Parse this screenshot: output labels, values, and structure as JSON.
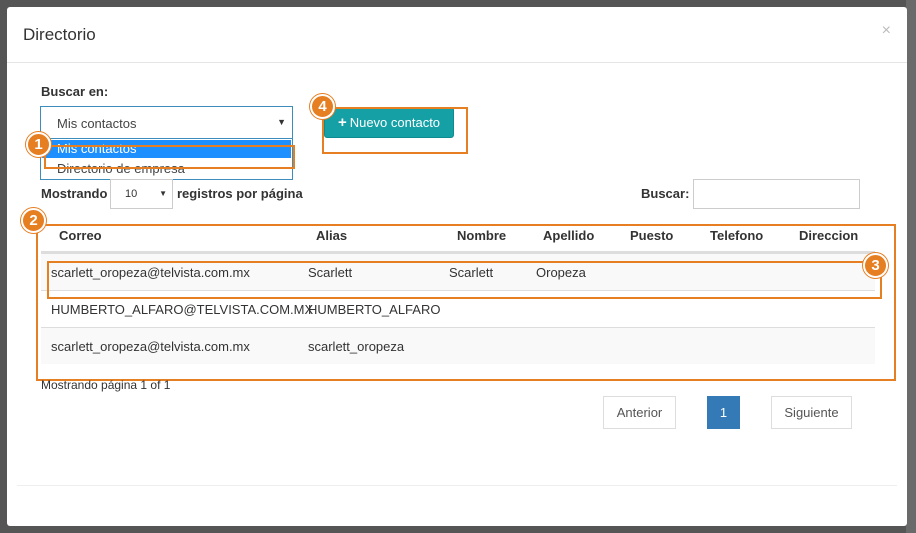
{
  "modal": {
    "title": "Directorio",
    "close": "×"
  },
  "search_in": {
    "label": "Buscar en:",
    "selected": "Mis contactos",
    "options": [
      "Mis contactos",
      "Directorio de empresa"
    ]
  },
  "new_contact_button": "Nuevo contacto",
  "length": {
    "prefix": "Mostrando",
    "value": "10",
    "suffix": "registros por página"
  },
  "search": {
    "label": "Buscar:",
    "value": ""
  },
  "table": {
    "headers": [
      "Correo",
      "Alias",
      "Nombre",
      "Apellido",
      "Puesto",
      "Telefono",
      "Direccion"
    ],
    "rows": [
      [
        "scarlett_oropeza@telvista.com.mx",
        "Scarlett",
        "Scarlett",
        "Oropeza"
      ],
      [
        "HUMBERTO_ALFARO@TELVISTA.COM.MX",
        "HUMBERTO_ALFARO",
        "",
        ""
      ],
      [
        "scarlett_oropeza@telvista.com.mx",
        "scarlett_oropeza",
        "",
        ""
      ]
    ]
  },
  "pagination": {
    "info": "Mostrando página 1 of 1",
    "prev": "Anterior",
    "page": "1",
    "next": "Siguiente"
  },
  "callouts": [
    "1",
    "2",
    "3",
    "4"
  ],
  "colors": {
    "callout": "#e67e22",
    "primary_button": "#15a0a6",
    "active_page": "#337ab7",
    "dropdown_highlight": "#1e8fff"
  }
}
